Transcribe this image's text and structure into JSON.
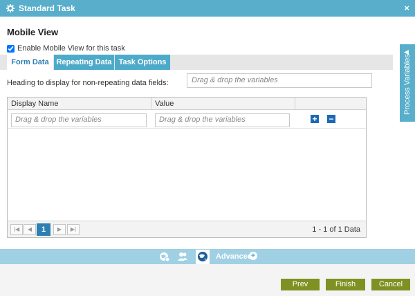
{
  "window": {
    "title": "Standard Task",
    "close_glyph": "×"
  },
  "page": {
    "heading": "Mobile View"
  },
  "enable_mobile": {
    "label": "Enable Mobile View for this task",
    "checked": true
  },
  "tabs": [
    {
      "label": "Form Data",
      "active": true
    },
    {
      "label": "Repeating Data",
      "active": false
    },
    {
      "label": "Task Options",
      "active": false
    }
  ],
  "heading_field": {
    "label": "Heading to display for non-repeating data fields:",
    "placeholder": "Drag & drop the variables"
  },
  "grid": {
    "columns": [
      "Display Name",
      "Value"
    ],
    "rows": [
      {
        "display_name_placeholder": "Drag & drop the variables",
        "value_placeholder": "Drag & drop the variables"
      }
    ],
    "add_glyph": "+",
    "remove_glyph": "−"
  },
  "pager": {
    "current_page": "1",
    "info": "1 - 1 of 1 Data"
  },
  "side_panel": {
    "label": "Process Variables"
  },
  "footer": {
    "advanced_label": "Advanced"
  },
  "buttons": {
    "prev": "Prev",
    "finish": "Finish",
    "cancel": "Cancel"
  },
  "colors": {
    "accent": "#58aecb",
    "primary_button": "#7f9122",
    "active_tab_text": "#2d7fb3",
    "icon_blue": "#1d69b5"
  },
  "icons": [
    "gear-icon",
    "close-icon",
    "checkbox-icon",
    "add-icon",
    "remove-icon",
    "first-page-icon",
    "prev-page-icon",
    "next-page-icon",
    "last-page-icon",
    "chevron-left-icon",
    "globe-settings-icon",
    "users-icon",
    "globe-icon",
    "plus-circle-icon"
  ]
}
